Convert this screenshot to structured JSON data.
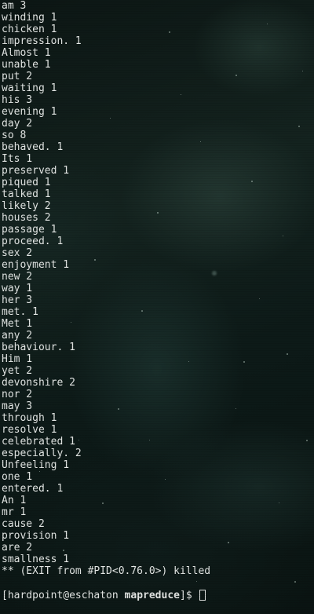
{
  "terminal": {
    "output_lines": [
      "am 3",
      "winding 1",
      "chicken 1",
      "impression. 1",
      "Almost 1",
      "unable 1",
      "put 2",
      "waiting 1",
      "his 3",
      "evening 1",
      "day 2",
      "so 8",
      "behaved. 1",
      "Its 1",
      "preserved 1",
      "piqued 1",
      "talked 1",
      "likely 2",
      "houses 2",
      "passage 1",
      "proceed. 1",
      "sex 2",
      "enjoyment 1",
      "new 2",
      "way 1",
      "her 3",
      "met. 1",
      "Met 1",
      "any 2",
      "behaviour. 1",
      "Him 1",
      "yet 2",
      "devonshire 2",
      "nor 2",
      "may 3",
      "through 1",
      "resolve 1",
      "celebrated 1",
      "especially. 2",
      "Unfeeling 1",
      "one 1",
      "entered. 1",
      "An 1",
      "mr 1",
      "cause 2",
      "provision 1",
      "are 2",
      "smallness 1",
      "** (EXIT from #PID<0.76.0>) killed"
    ],
    "prompt": {
      "open_bracket": "[",
      "user_host": "hardpoint@eschaton",
      "cwd": "mapreduce",
      "close": "]$ "
    },
    "colors": {
      "text": "#e4e7e5",
      "background": "#0b1210"
    }
  }
}
